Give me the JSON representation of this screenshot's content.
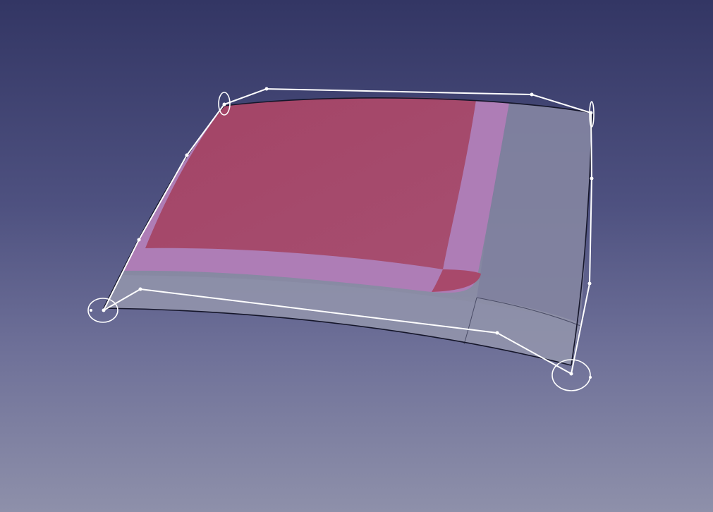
{
  "scene": {
    "view": "3d-viewport",
    "background_top": "#333664",
    "background_bottom": "#8e90aa",
    "surface_color": "#8a8cab",
    "trimmed_face_color": "#a5496a",
    "border_band_color": "#b07fb7",
    "control_polygon_color": "#ffffff",
    "edge_color": "#101018"
  }
}
